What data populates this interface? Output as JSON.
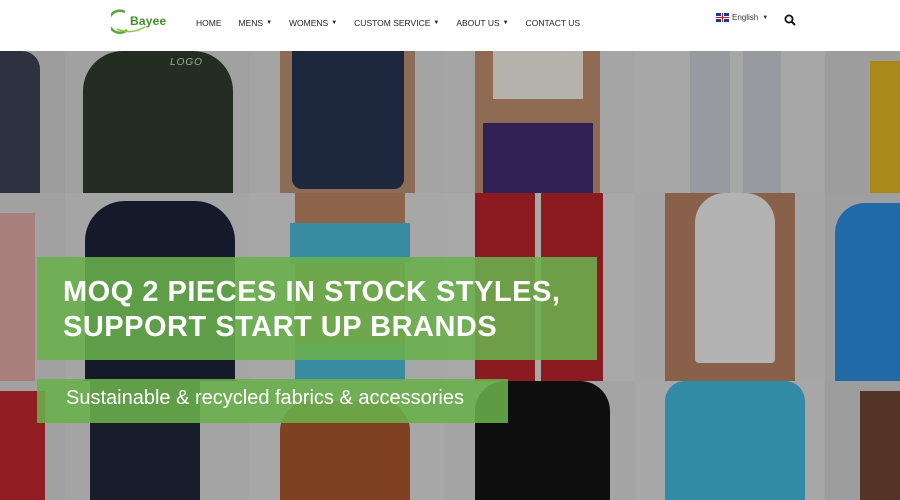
{
  "header": {
    "logo_text": "Bayee",
    "nav": [
      {
        "label": "HOME",
        "dropdown": false
      },
      {
        "label": "MENS",
        "dropdown": true
      },
      {
        "label": "WOMENS",
        "dropdown": true
      },
      {
        "label": "CUSTOM SERVICE",
        "dropdown": true
      },
      {
        "label": "ABOUT US",
        "dropdown": true
      },
      {
        "label": "CONTACT US",
        "dropdown": false
      }
    ],
    "language": "English",
    "caret": "▼"
  },
  "hero": {
    "headline_line1": "MOQ 2 PIECES IN STOCK STYLES,",
    "headline_line2": "SUPPORT START UP BRANDS",
    "subline": "Sustainable & recycled fabrics & accessories",
    "garment_print": "LOGO"
  },
  "colors": {
    "accent_green": "#6ab04c",
    "logo_green": "#3f8f2f",
    "nav_text": "#222222"
  },
  "icons": {
    "search": "search-icon",
    "language_flag": "uk-flag-icon"
  }
}
